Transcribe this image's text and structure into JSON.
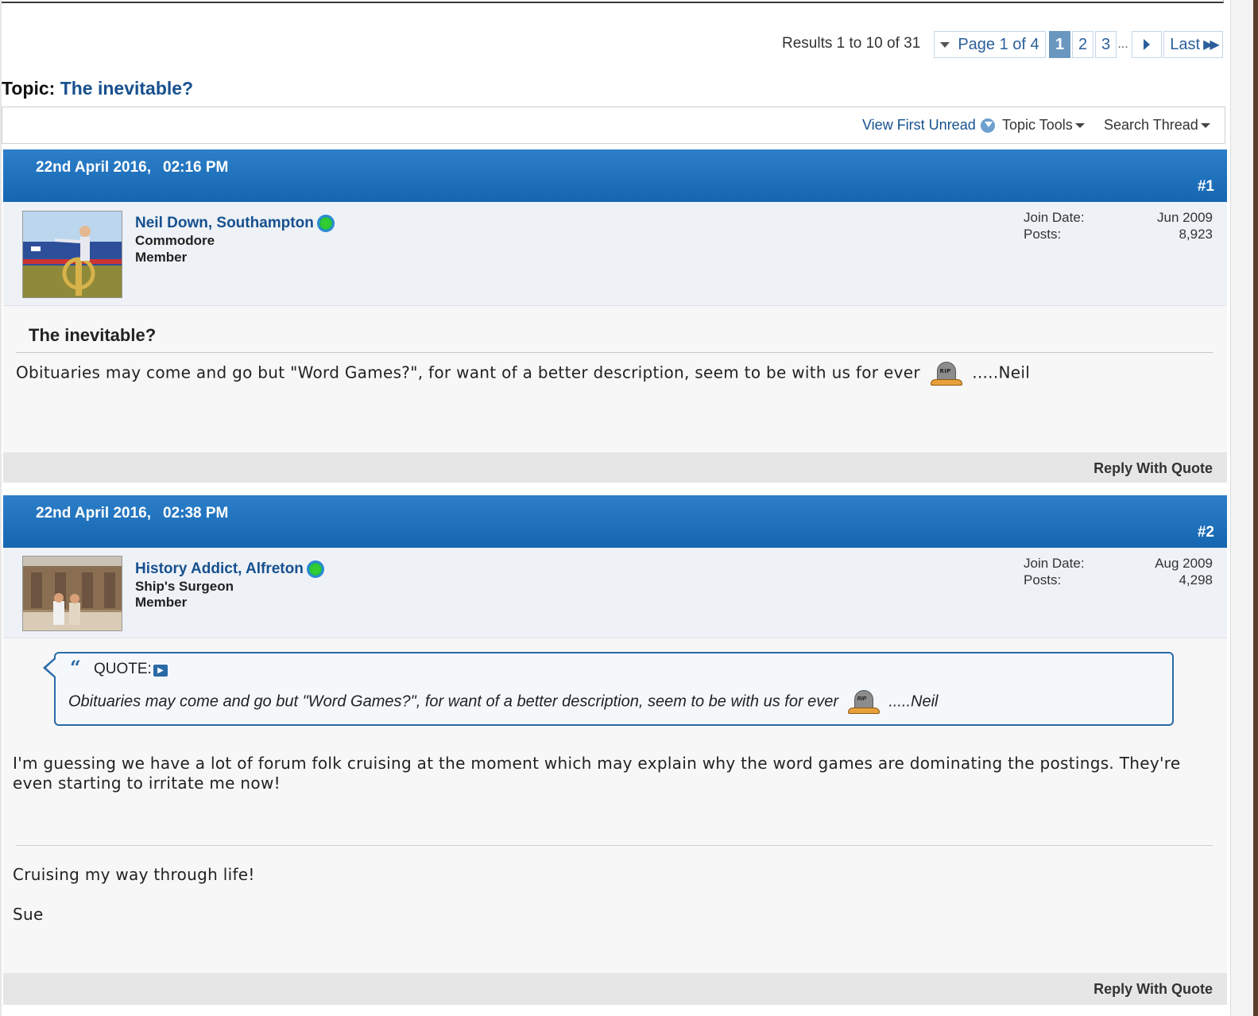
{
  "pagination": {
    "results": "Results 1 to 10 of 31",
    "page_of": "Page 1 of 4",
    "pages": [
      "1",
      "2",
      "3"
    ],
    "ellipsis": "...",
    "last": "Last"
  },
  "topic": {
    "prefix": "Topic:",
    "title": "The inevitable?"
  },
  "toolbar": {
    "view_first_unread": "View First Unread",
    "topic_tools": "Topic Tools",
    "search_thread": "Search Thread"
  },
  "posts": [
    {
      "date": "22nd April 2016,",
      "time": "02:16 PM",
      "number": "#1",
      "username": "Neil Down, Southampton",
      "rank": "Commodore",
      "role": "Member",
      "join_date_label": "Join Date:",
      "join_date": "Jun 2009",
      "posts_label": "Posts:",
      "posts": "8,923",
      "title": "The inevitable?",
      "message_before": "Obituaries may come and go but \"Word Games?\", for want of a better description, seem to be with us for ever",
      "message_after": ".....Neil",
      "reply": "Reply With Quote"
    },
    {
      "date": "22nd April 2016,",
      "time": "02:38 PM",
      "number": "#2",
      "username": "History Addict, Alfreton",
      "rank": "Ship's Surgeon",
      "role": "Member",
      "join_date_label": "Join Date:",
      "join_date": "Aug 2009",
      "posts_label": "Posts:",
      "posts": "4,298",
      "quote_label": "QUOTE:",
      "quote_before": "Obituaries may come and go but \"Word Games?\", for want of a better description, seem to be with us for ever",
      "quote_after": ".....Neil",
      "message_line1": "I'm guessing we have a lot of forum folk cruising at the moment which may explain why the word games are dominating the postings. They're",
      "message_line2": "even starting to irritate me now!",
      "signature_line1": "Cruising my way through life!",
      "signature_line2": "Sue",
      "reply": "Reply With Quote"
    }
  ],
  "icons": {
    "online": "online-status-icon",
    "rip": "rip-tombstone-smiley",
    "quote": "quote-marks-icon",
    "jump": "view-post-icon"
  },
  "colors": {
    "header_blue": "#1a6fbd",
    "link_blue": "#17508f",
    "current_page": "#6a97c0"
  }
}
